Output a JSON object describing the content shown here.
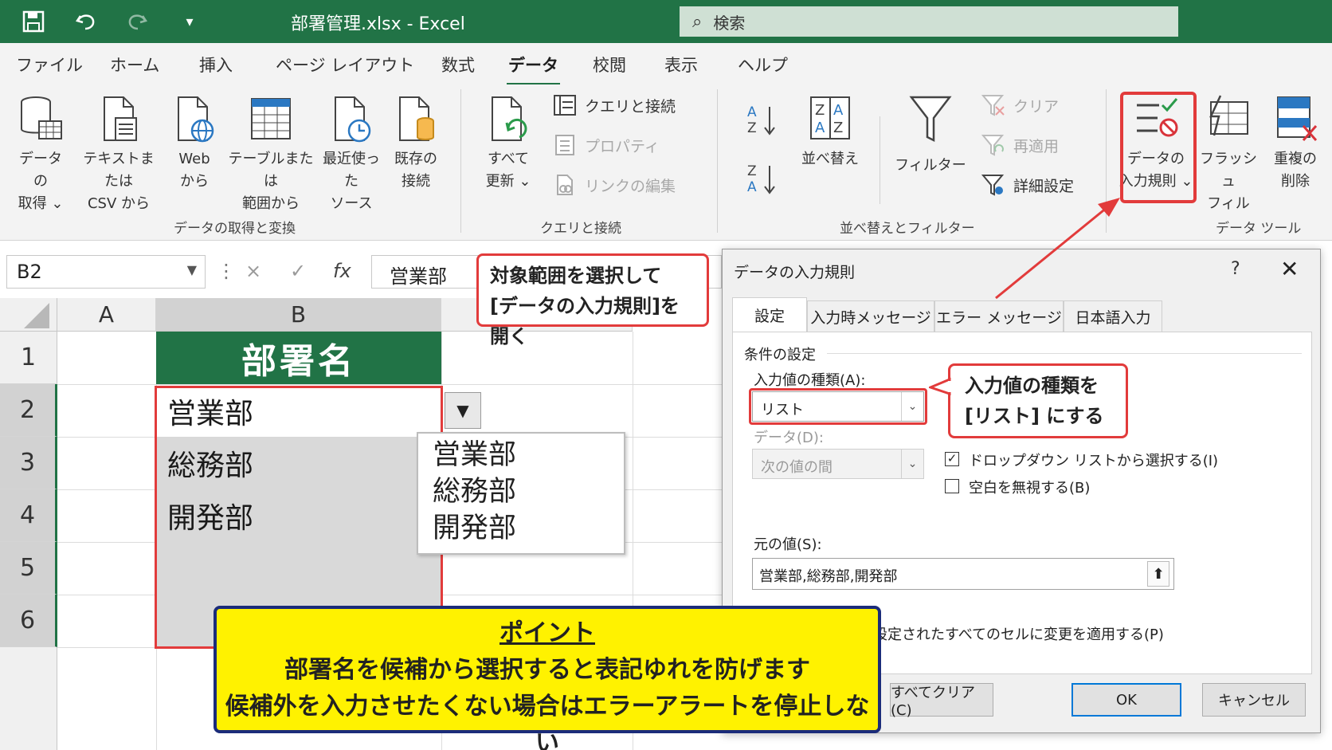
{
  "titlebar": {
    "title": "部署管理.xlsx  -  Excel",
    "search_placeholder": "検索"
  },
  "menu": [
    "ファイル",
    "ホーム",
    "挿入",
    "ページ レイアウト",
    "数式",
    "データ",
    "校閲",
    "表示",
    "ヘルプ"
  ],
  "menu_active": "データ",
  "ribbon": {
    "get_data": "データの\n取得 ⌄",
    "from_text_csv": "テキストまたは\nCSV から",
    "from_web": "Web\nから",
    "from_table": "テーブルまたは\n範囲から",
    "recent_sources": "最近使った\nソース",
    "existing_conn": "既存の\n接続",
    "group_get": "データの取得と変換",
    "refresh_all": "すべて\n更新 ⌄",
    "queries_conn": "クエリと接続",
    "properties": "プロパティ",
    "edit_links": "リンクの編集",
    "group_queries": "クエリと接続",
    "sort": "並べ替え",
    "filter": "フィルター",
    "clear": "クリア",
    "reapply": "再適用",
    "advanced": "詳細設定",
    "group_sort": "並べ替えとフィルター",
    "data_validation": "データの\n入力規則 ⌄",
    "flash_fill": "フラッシュ\nフィル",
    "remove_dup": "重複の\n削除",
    "group_tools": "データ ツール"
  },
  "formula_bar": {
    "name_box": "B2",
    "cancel": "×",
    "enter": "✓",
    "fx": "fx",
    "value": "営業部"
  },
  "grid": {
    "col_a": "A",
    "col_b": "B",
    "rows": [
      "1",
      "2",
      "3",
      "4",
      "5",
      "6"
    ],
    "header": "部署名",
    "cells": [
      "営業部",
      "総務部",
      "開発部"
    ]
  },
  "dropdown_items": [
    "営業部",
    "総務部",
    "開発部"
  ],
  "callout_top": "対象範囲を選択して\n[データの入力規則]を開く",
  "callout_list": "入力値の種類を\n[リスト] にする",
  "point": {
    "title": "ポイント",
    "line1": "部署名を候補から選択すると表記ゆれを防げます",
    "line2": "候補外を入力させたくない場合はエラーアラートを停止しない"
  },
  "dialog": {
    "title": "データの入力規則",
    "help": "?",
    "close": "✕",
    "tabs": [
      "設定",
      "入力時メッセージ",
      "エラー メッセージ",
      "日本語入力"
    ],
    "section": "条件の設定",
    "type_label": "入力値の種類(A):",
    "type_value": "リスト",
    "data_label": "データ(D):",
    "data_value": "次の値の間",
    "dropdown_check": "ドロップダウン リストから選択する(I)",
    "ignore_blank": "空白を無視する(B)",
    "source_label": "元の値(S):",
    "source_value": "営業部,総務部,開発部",
    "apply_all": "同じ入力規則が設定されたすべてのセルに変更を適用する(P)",
    "clear_all": "すべてクリア(C)",
    "ok": "OK",
    "cancel": "キャンセル"
  },
  "colors": {
    "excel_green": "#217346",
    "highlight_red": "#e23b3b",
    "point_yellow": "#fff200",
    "point_border": "#1b2c7a"
  }
}
